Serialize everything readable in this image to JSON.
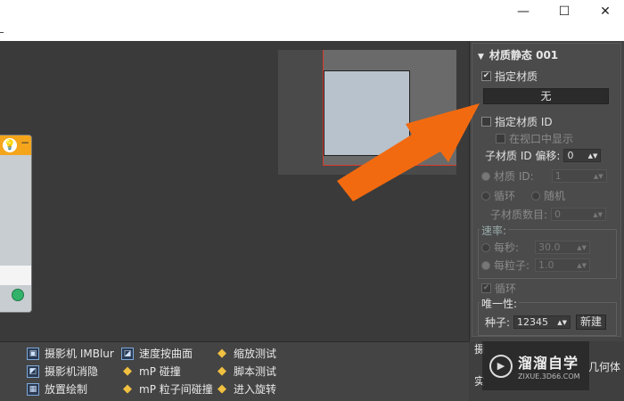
{
  "window": {
    "minimize_glyph": "—",
    "maximize_glyph": "☐",
    "close_glyph": "✕"
  },
  "canvas": {
    "node": {
      "bulb_glyph": "💡",
      "minus_glyph": "−"
    }
  },
  "panel": {
    "title": "材质静态 001",
    "assign_material_label": "指定材质",
    "assign_material_checked": true,
    "material_button": "无",
    "assign_material_id_label": "指定材质 ID",
    "show_in_viewport_label": "在视口中显示",
    "submaterial_offset_label": "子材质 ID 偏移:",
    "submaterial_offset_value": "0",
    "material_id_label": "材质 ID:",
    "material_id_value": "1",
    "cycle_label": "循环",
    "random_label": "随机",
    "submaterial_count_label": "子材质数目:",
    "submaterial_count_value": "0",
    "rate_group_label": "速率:",
    "per_second_label": "每秒:",
    "per_second_value": "30.0",
    "per_particle_label": "每粒子:",
    "per_particle_value": "1.0",
    "loop_label": "循环",
    "uniqueness_label": "唯一性:",
    "seed_label": "种子:",
    "seed_value": "12345",
    "new_button": "新建"
  },
  "bottom_tools": [
    {
      "icon": "camera-imblur-icon",
      "label": "摄影机 IMBlur"
    },
    {
      "icon": "camera-culling-icon",
      "label": "摄影机消隐"
    },
    {
      "icon": "placement-paint-icon",
      "label": "放置绘制"
    },
    {
      "icon": "speed-by-surface-icon",
      "label": "速度按曲面"
    },
    {
      "icon": "collision-icon",
      "label": "mP 碰撞"
    },
    {
      "icon": "particle-collision-icon",
      "label": "mP 粒子间碰撞"
    },
    {
      "icon": "scale-test-icon",
      "label": "缩放测试"
    },
    {
      "icon": "script-test-icon",
      "label": "脚本测试"
    },
    {
      "icon": "spin-icon",
      "label": "进入旋转"
    }
  ],
  "bottom_right": {
    "text_top": "摄",
    "text_mid": "几何体",
    "text_bottom": "实"
  },
  "watermark": {
    "brand": "溜溜自学",
    "url": "ZIXUE.3D66.COM",
    "logo_glyph": "▶"
  },
  "colors": {
    "accent_orange": "#f26a10",
    "node_header": "#f4a51c",
    "selection_red": "#d43a2a"
  }
}
